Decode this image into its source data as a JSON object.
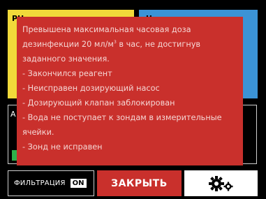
{
  "background_tiles": {
    "yellow_peek": "PH",
    "blue_peek": "Ч",
    "dark_peek": "А"
  },
  "bottom_bar": {
    "filter_label": "ФИЛЬТРАЦИЯ",
    "filter_state": "ON",
    "close_label": "ЗАКРЫТЬ",
    "settings_icon": "gears-icon"
  },
  "alert": {
    "message_main": "Превышена максимальная часовая доза дезинфекции 20 мл/м",
    "message_sup": "3",
    "message_tail": " в час, не достигнув заданного значения.",
    "reasons": [
      "- Закончился реагент",
      "- Неисправен дозирующий насос",
      "- Дозирующий клапан заблокирован",
      "- Вода не поступает к зондам в измерительные ячейки.",
      "- Зонд не исправен"
    ]
  },
  "colors": {
    "alert_red": "#c9302c",
    "yellow": "#f1d93a",
    "blue": "#3b93d6",
    "green": "#2fb24b"
  }
}
